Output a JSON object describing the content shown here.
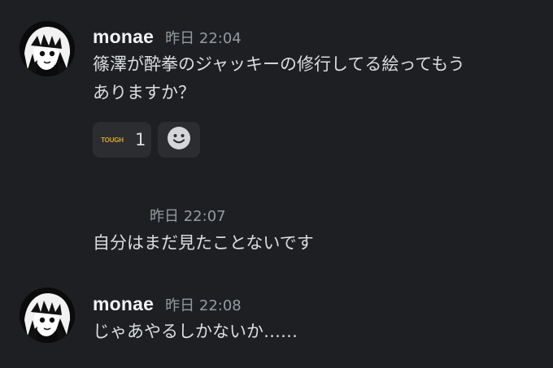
{
  "messages": [
    {
      "username": "monae",
      "timestamp": "昨日 22:04",
      "text": "篠澤が酔拳のジャッキーの修行してる絵ってもう\nありますか？",
      "reactions": [
        {
          "emoji_text": "TOUGH",
          "count": "1"
        }
      ],
      "add_reaction_icon": "smile-icon"
    },
    {
      "timestamp": "昨日 22:07",
      "text": "自分はまだ見たことないです"
    },
    {
      "username": "monae",
      "timestamp": "昨日 22:08",
      "text": "じゃあやるしかないか……"
    }
  ]
}
